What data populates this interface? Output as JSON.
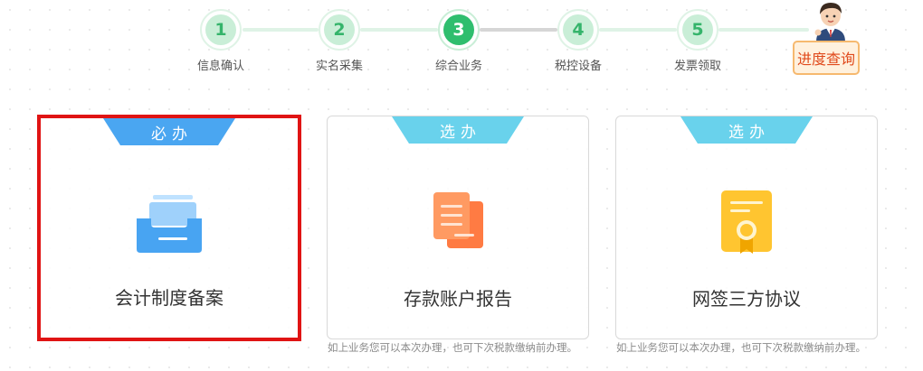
{
  "steps": [
    {
      "number": "1",
      "label": "信息确认",
      "active": false
    },
    {
      "number": "2",
      "label": "实名采集",
      "active": false
    },
    {
      "number": "3",
      "label": "综合业务",
      "active": true
    },
    {
      "number": "4",
      "label": "税控设备",
      "active": false
    },
    {
      "number": "5",
      "label": "发票领取",
      "active": false
    }
  ],
  "progress_query": {
    "label": "进度查询"
  },
  "cards": [
    {
      "tag": "必办",
      "title": "会计制度备案",
      "icon": "inbox-tray-icon",
      "selected": true
    },
    {
      "tag": "选办",
      "title": "存款账户报告",
      "icon": "documents-icon",
      "selected": false,
      "note": "如上业务您可以本次办理，也可下次税款缴纳前办理。"
    },
    {
      "tag": "选办",
      "title": "网签三方协议",
      "icon": "certificate-icon",
      "selected": false,
      "note": "如上业务您可以本次办理，也可下次税款缴纳前办理。"
    }
  ],
  "colors": {
    "step_active": "#2fbe6e",
    "step_inactive": "#c9eed7",
    "tag_required": "#4aa6f1",
    "tag_optional": "#69d2ec",
    "selected_border": "#e01414",
    "query_text": "#e04a1c"
  }
}
